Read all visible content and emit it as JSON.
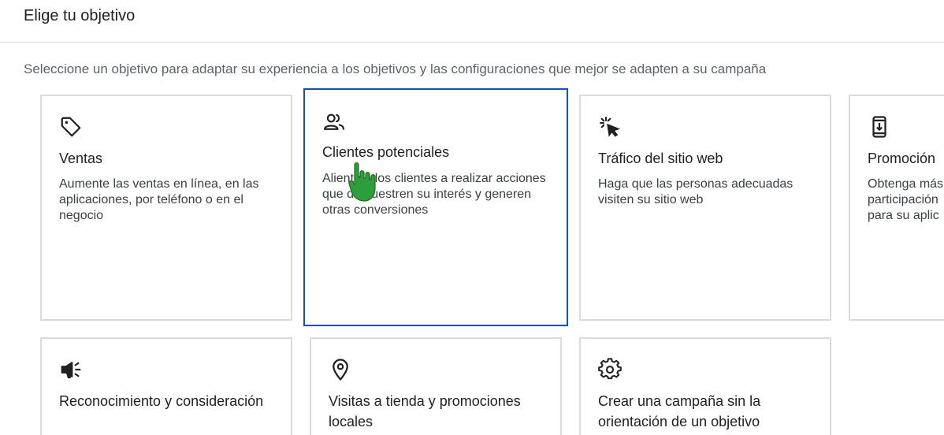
{
  "header": {
    "title": "Elige tu objetivo"
  },
  "subtitle": "Seleccione un objetivo para adaptar su experiencia a los objetivos y las configuraciones que mejor se adapten a su campaña",
  "cards": [
    {
      "icon": "tag-icon",
      "title": "Ventas",
      "description": "Aumente las ventas en línea, en las aplicaciones, por teléfono o en el negocio",
      "selected": false
    },
    {
      "icon": "people-icon",
      "title": "Clientes potenciales",
      "description": "Aliente a los clientes a realizar acciones que demuestren su interés y generen otras conversiones",
      "selected": true
    },
    {
      "icon": "cursor-click-icon",
      "title": "Tráfico del sitio web",
      "description": "Haga que las personas adecuadas visiten su sitio web",
      "selected": false
    },
    {
      "icon": "mobile-phone-icon",
      "title": "Promoción",
      "description": "Obtenga más participación para su aplic",
      "selected": false
    },
    {
      "icon": "megaphone-icon",
      "title": "Reconocimiento y consideración",
      "description": "",
      "selected": false
    },
    {
      "icon": "location-pin-icon",
      "title": "Visitas a tienda y promociones locales",
      "description": "",
      "selected": false
    },
    {
      "icon": "gear-icon",
      "title": "Crear una campaña sin la orientación de un objetivo",
      "description": "",
      "selected": false
    }
  ],
  "colors": {
    "selected_border": "#1a4fb5",
    "card_border": "#dadce0",
    "cursor": "#2e9e3a"
  }
}
